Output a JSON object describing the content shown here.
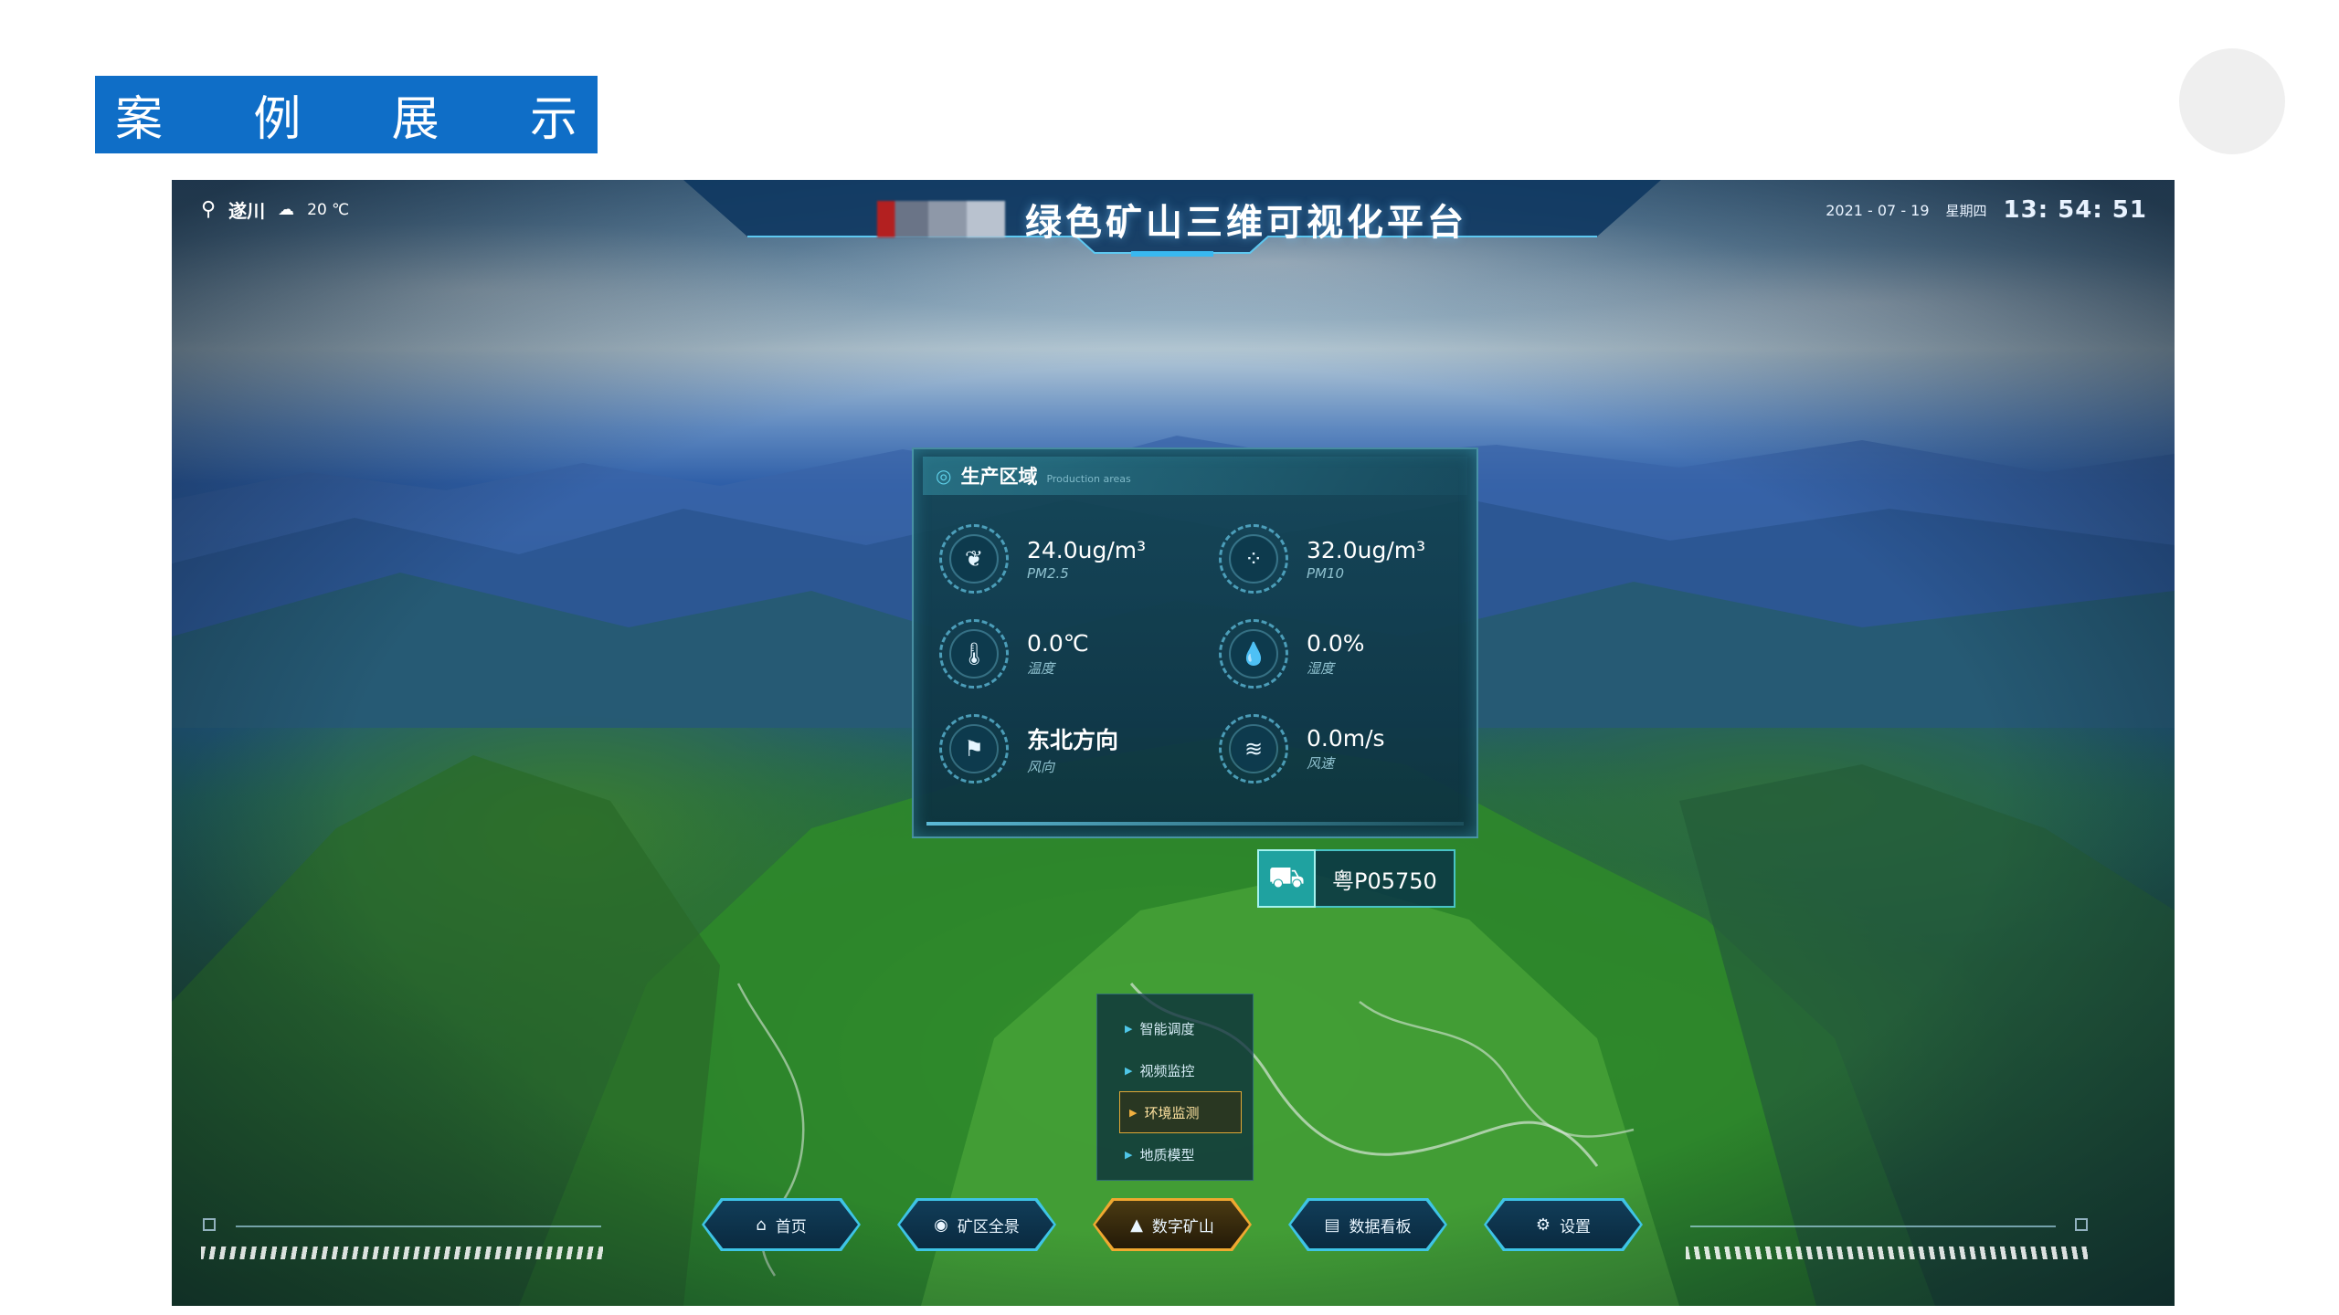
{
  "slide": {
    "banner_chars": [
      "案",
      "例",
      "展",
      "示"
    ]
  },
  "app": {
    "title": "绿色矿山三维可视化平台",
    "location": "遂川",
    "weather_temp": "20 ℃",
    "date": "2021 - 07 - 19",
    "weekday": "星期四",
    "time": "13: 54: 51"
  },
  "panel": {
    "title": "生产区域",
    "subtitle": "Production areas",
    "metrics": [
      {
        "value": "24.0ug/m³",
        "label": "PM2.5",
        "icon": "leaf-icon"
      },
      {
        "value": "32.0ug/m³",
        "label": "PM10",
        "icon": "particles-icon"
      },
      {
        "value": "0.0℃",
        "label": "温度",
        "icon": "thermometer-icon"
      },
      {
        "value": "0.0%",
        "label": "湿度",
        "icon": "water-drop-icon"
      },
      {
        "value": "东北方向",
        "label": "风向",
        "icon": "wind-vane-icon"
      },
      {
        "value": "0.0m/s",
        "label": "风速",
        "icon": "wind-icon"
      }
    ]
  },
  "vehicle": {
    "plate": "粤P05750",
    "icon": "dump-truck-icon"
  },
  "sub_menu": {
    "items": [
      {
        "label": "智能调度",
        "active": false
      },
      {
        "label": "视频监控",
        "active": false
      },
      {
        "label": "环境监测",
        "active": true
      },
      {
        "label": "地质模型",
        "active": false
      }
    ]
  },
  "nav": {
    "items": [
      {
        "label": "首页",
        "icon": "home-icon",
        "active": false
      },
      {
        "label": "矿区全景",
        "icon": "panorama-icon",
        "active": false
      },
      {
        "label": "数字矿山",
        "icon": "mountain-icon",
        "active": true
      },
      {
        "label": "数据看板",
        "icon": "dashboard-icon",
        "active": false
      },
      {
        "label": "设置",
        "icon": "gear-icon",
        "active": false
      }
    ]
  },
  "colors": {
    "banner": "#0f6ec7",
    "accent_cyan": "#3ec4e6",
    "accent_gold": "#f0a830",
    "vehicle_teal": "#1fa2a0"
  }
}
